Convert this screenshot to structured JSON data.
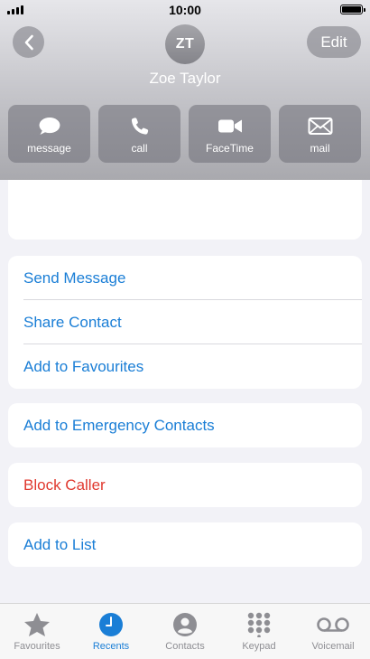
{
  "status_bar": {
    "time": "10:00"
  },
  "header": {
    "avatar_initials": "ZT",
    "contact_name": "Zoe Taylor",
    "edit_label": "Edit"
  },
  "actions": [
    {
      "label": "message",
      "icon": "message-bubble-icon"
    },
    {
      "label": "call",
      "icon": "phone-icon"
    },
    {
      "label": "FaceTime",
      "icon": "video-camera-icon"
    },
    {
      "label": "mail",
      "icon": "envelope-icon"
    }
  ],
  "menu_group_1": [
    "Send Message",
    "Share Contact",
    "Add to Favourites"
  ],
  "menu_group_2": [
    "Add to Emergency Contacts"
  ],
  "menu_group_3": [
    "Block Caller"
  ],
  "menu_group_4": [
    "Add to List"
  ],
  "tab_bar": {
    "active": "Recents",
    "tabs": [
      {
        "label": "Favourites",
        "icon": "star-icon"
      },
      {
        "label": "Recents",
        "icon": "clock-icon"
      },
      {
        "label": "Contacts",
        "icon": "person-icon"
      },
      {
        "label": "Keypad",
        "icon": "keypad-icon"
      },
      {
        "label": "Voicemail",
        "icon": "voicemail-icon"
      }
    ]
  },
  "colors": {
    "accent": "#1a7ed6",
    "danger": "#e0392f",
    "inactive": "#8e8e93",
    "background": "#f2f2f7"
  }
}
